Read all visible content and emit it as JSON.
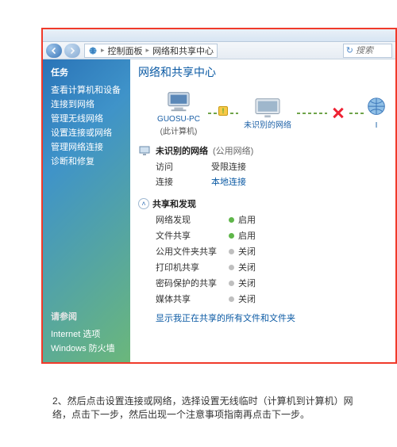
{
  "breadcrumb": {
    "a": "控制面板",
    "b": "网络和共享中心"
  },
  "search": {
    "placeholder": "搜索"
  },
  "sidebar": {
    "header": "任务",
    "items": [
      {
        "label": "查看计算机和设备"
      },
      {
        "label": "连接到网络"
      },
      {
        "label": "管理无线网络"
      },
      {
        "label": "设置连接或网络"
      },
      {
        "label": "管理网络连接"
      },
      {
        "label": "诊断和修复"
      }
    ],
    "seeAlsoHeader": "请参阅",
    "seeAlso": [
      {
        "label": "Internet 选项"
      },
      {
        "label": "Windows 防火墙"
      }
    ]
  },
  "main": {
    "title": "网络和共享中心",
    "map": {
      "node1": "GUOSU-PC",
      "node1sub": "(此计算机)",
      "node2": "未识别的网络",
      "node3": "I"
    },
    "unknown": {
      "title": "未识别的网络",
      "subtitle": "(公用网络)",
      "rows": [
        {
          "k": "访问",
          "v": "受限连接"
        },
        {
          "k": "连接",
          "v": "本地连接",
          "link": true
        }
      ]
    },
    "share": {
      "title": "共享和发现",
      "rows": [
        {
          "name": "网络发现",
          "state": "启用",
          "on": true
        },
        {
          "name": "文件共享",
          "state": "启用",
          "on": true
        },
        {
          "name": "公用文件夹共享",
          "state": "关闭",
          "on": false
        },
        {
          "name": "打印机共享",
          "state": "关闭",
          "on": false
        },
        {
          "name": "密码保护的共享",
          "state": "关闭",
          "on": false
        },
        {
          "name": "媒体共享",
          "state": "关闭",
          "on": false
        }
      ],
      "link1": "显示我正在共享的所有文件和文件夹"
    }
  },
  "caption": "2、然后点击设置连接或网络，选择设置无线临时（计算机到计算机）网络，点击下一步，然后出现一个注意事项指南再点击下一步。"
}
